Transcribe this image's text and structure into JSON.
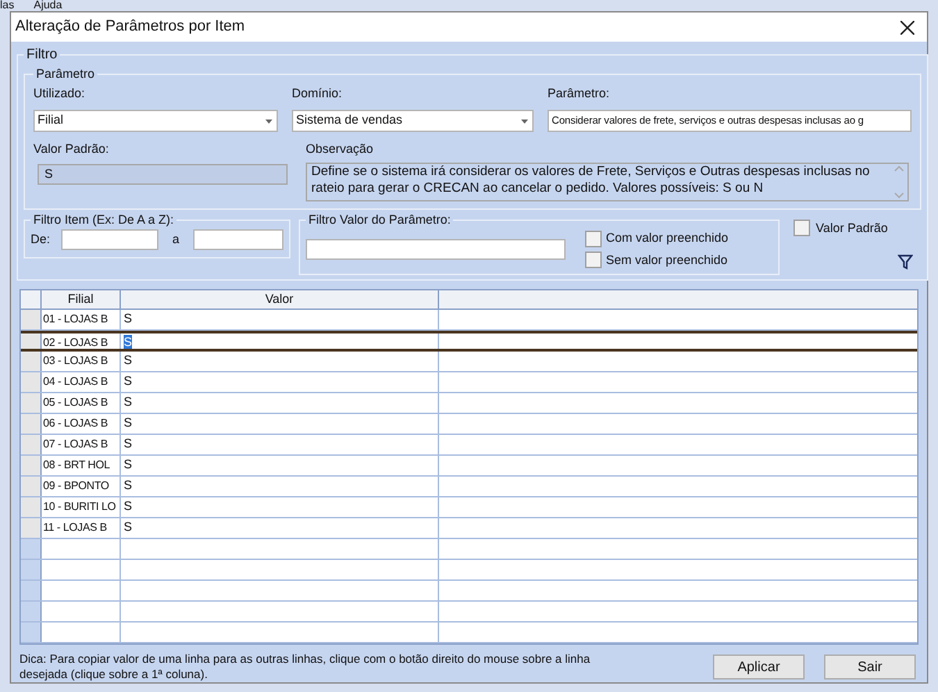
{
  "background_menu": [
    "las",
    "Ajuda"
  ],
  "window": {
    "title": "Alteração de Parâmetros por Item"
  },
  "filter_group": {
    "legend": "Filtro",
    "parameter_group": {
      "legend": "Parâmetro",
      "utilizado": {
        "label": "Utilizado:",
        "value": "Filial"
      },
      "dominio": {
        "label": "Domínio:",
        "value": "Sistema de vendas"
      },
      "parametro": {
        "label": "Parâmetro:",
        "value": "Considerar valores de frete, serviços e outras despesas inclusas ao g"
      },
      "valor_padrao": {
        "label": "Valor Padrão:",
        "value": "S"
      },
      "observacao": {
        "label": "Observação",
        "value": "Define se o sistema irá considerar os valores de Frete, Serviços e Outras despesas inclusas no rateio para gerar o CRECAN ao cancelar o pedido. Valores possíveis: S ou N"
      }
    },
    "item_filter": {
      "legend": "Filtro Item (Ex: De A a Z):",
      "from_label": "De:",
      "to_label": "a"
    },
    "value_filter": {
      "legend": "Filtro Valor do Parâmetro:",
      "options": [
        {
          "label": "Com valor preenchido",
          "checked": false
        },
        {
          "label": "Sem valor preenchido",
          "checked": false
        }
      ]
    },
    "default_value": {
      "label": "Valor Padrão",
      "checked": false
    }
  },
  "table": {
    "columns": [
      "Filial",
      "Valor"
    ],
    "rows": [
      {
        "filial": "01 - LOJAS B",
        "valor": "S",
        "selected": false
      },
      {
        "filial": "02 - LOJAS B",
        "valor": "S",
        "selected": true
      },
      {
        "filial": "03 - LOJAS B",
        "valor": "S",
        "selected": false
      },
      {
        "filial": "04 - LOJAS B",
        "valor": "S",
        "selected": false
      },
      {
        "filial": "05 - LOJAS B",
        "valor": "S",
        "selected": false
      },
      {
        "filial": "06 - LOJAS B",
        "valor": "S",
        "selected": false
      },
      {
        "filial": "07 - LOJAS B",
        "valor": "S",
        "selected": false
      },
      {
        "filial": "08 - BRT HOL",
        "valor": "S",
        "selected": false
      },
      {
        "filial": "09 - BPONTO",
        "valor": "S",
        "selected": false
      },
      {
        "filial": "10 - BURITI LO",
        "valor": "S",
        "selected": false
      },
      {
        "filial": "11 - LOJAS B",
        "valor": "S",
        "selected": false
      }
    ]
  },
  "hint": "Dica: Para copiar valor de uma linha para as outras linhas, clique com o botão direito do mouse sobre a linha desejada (clique sobre a 1ª coluna).",
  "buttons": [
    "Aplicar",
    "Sair"
  ]
}
